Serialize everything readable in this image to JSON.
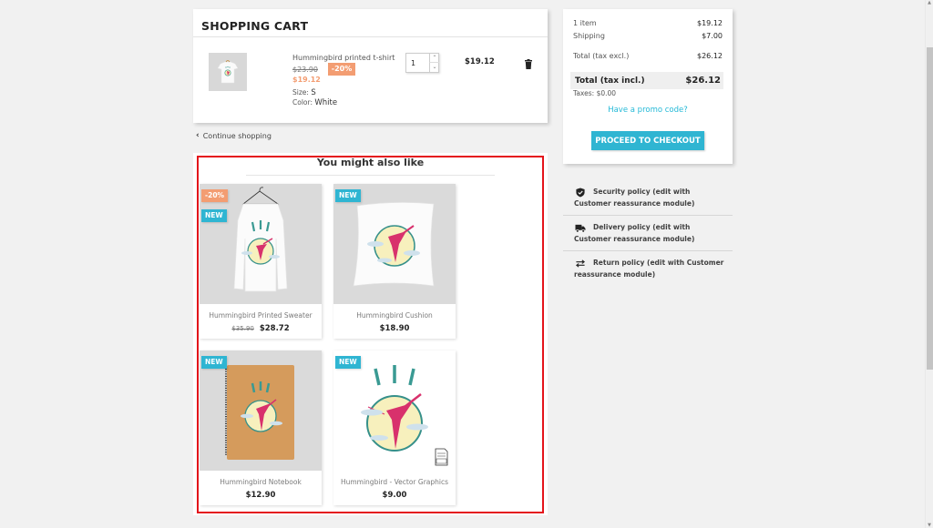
{
  "cart": {
    "title": "SHOPPING CART",
    "item": {
      "name": "Hummingbird printed t-shirt",
      "regular_price": "$23.90",
      "discount": "-20%",
      "price": "$19.12",
      "size_label": "Size:",
      "size_value": "S",
      "color_label": "Color:",
      "color_value": "White",
      "quantity": "1",
      "line_total": "$19.12",
      "qty_up_icon": "chevron-up",
      "qty_down_icon": "chevron-down",
      "delete_icon": "trash-icon"
    }
  },
  "continue_shopping": "Continue shopping",
  "summary": {
    "items_label": "1 item",
    "items_value": "$19.12",
    "shipping_label": "Shipping",
    "shipping_value": "$7.00",
    "total_excl_label": "Total (tax excl.)",
    "total_excl_value": "$26.12",
    "total_incl_label": "Total (tax incl.)",
    "total_incl_value": "$26.12",
    "taxes": "Taxes: $0.00",
    "promo_link": "Have a promo code?",
    "checkout_button": "PROCEED TO CHECKOUT"
  },
  "reassurance": [
    {
      "icon": "shield-icon",
      "text": "Security policy (edit with Customer reassurance module)"
    },
    {
      "icon": "truck-icon",
      "text": "Delivery policy (edit with Customer reassurance module)"
    },
    {
      "icon": "swap-arrows-icon",
      "text": "Return policy (edit with Customer reassurance module)"
    }
  ],
  "suggestions": {
    "title": "You might also like",
    "products": [
      {
        "name": "Hummingbird Printed Sweater",
        "regular_price": "$35.90",
        "price": "$28.72",
        "flags": [
          "-20%",
          "NEW"
        ]
      },
      {
        "name": "Hummingbird Cushion",
        "price": "$18.90",
        "flags": [
          "NEW"
        ]
      },
      {
        "name": "Hummingbird Notebook",
        "price": "$12.90",
        "flags": [
          "NEW"
        ]
      },
      {
        "name": "Hummingbird - Vector Graphics",
        "price": "$9.00",
        "flags": [
          "NEW"
        ]
      }
    ]
  },
  "colors": {
    "accent": "#2fb5d2",
    "discount": "#f39d72",
    "highlight_border": "#e4141b"
  }
}
